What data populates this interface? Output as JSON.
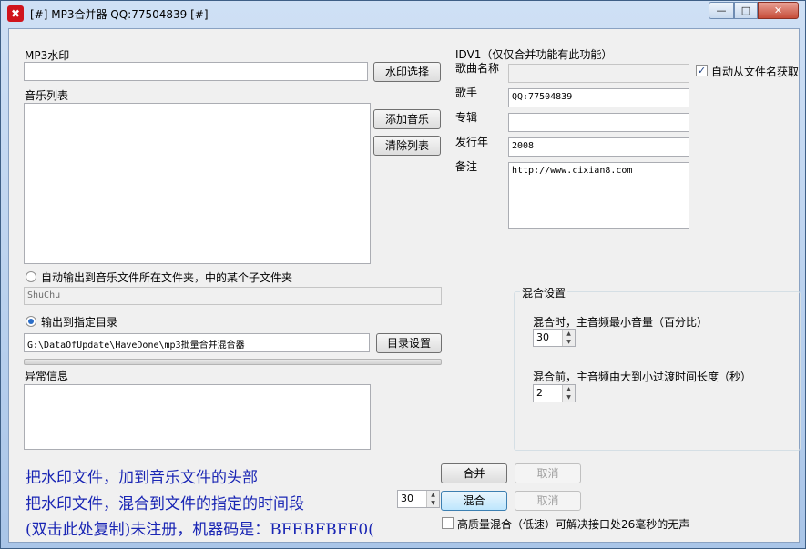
{
  "window": {
    "title": "[#] MP3合并器 QQ:77504839 [#]",
    "icon_glyph": "✖",
    "minimize_glyph": "—",
    "maximize_glyph": "□",
    "close_glyph": "✕"
  },
  "watermark": {
    "label": "MP3水印",
    "value": "",
    "button": "水印选择"
  },
  "music": {
    "label": "音乐列表",
    "items": [],
    "add_button": "添加音乐",
    "clear_button": "清除列表"
  },
  "output": {
    "auto_radio_label": "自动输出到音乐文件所在文件夹，中的某个子文件夹",
    "auto_radio_selected": false,
    "subfolder_value": "ShuChu",
    "dir_radio_label": "输出到指定目录",
    "dir_radio_selected": true,
    "dir_value": "G:\\DataOfUpdate\\HaveDone\\mp3批量合并混合器",
    "dir_button": "目录设置"
  },
  "errors": {
    "label": "异常信息",
    "value": ""
  },
  "id3": {
    "header": "IDV1（仅仅合并功能有此功能）",
    "song_label": "歌曲名称",
    "song_value": "",
    "auto_checkbox_label": "自动从文件名获取",
    "auto_checkbox_checked": true,
    "artist_label": "歌手",
    "artist_value": "QQ:77504839",
    "album_label": "专辑",
    "album_value": "",
    "year_label": "发行年",
    "year_value": "2008",
    "comment_label": "备注",
    "comment_value": "http://www.cixian8.com"
  },
  "mix": {
    "group_label": "混合设置",
    "min_volume_label": "混合时，主音频最小音量（百分比）",
    "min_volume_value": "30",
    "fade_label": "混合前，主音频由大到小过渡时间长度（秒）",
    "fade_value": "2"
  },
  "actions": {
    "merge_button": "合并",
    "merge_cancel": "取消",
    "mix_button": "混合",
    "mix_cancel": "取消",
    "offset_value": "30",
    "hq_checkbox_label": "高质量混合（低速）可解决接口处26毫秒的无声",
    "hq_checkbox_checked": false
  },
  "notes": {
    "line1": "把水印文件，加到音乐文件的头部",
    "line2": "把水印文件，混合到文件的指定的时间段",
    "line3": "(双击此处复制)未注册，机器码是：BFEBFBFF0("
  }
}
